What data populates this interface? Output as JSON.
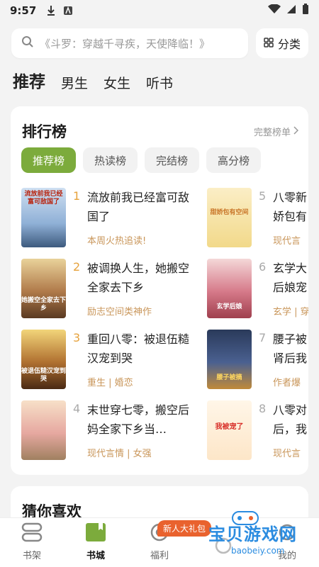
{
  "status_bar": {
    "time": "9:57"
  },
  "search": {
    "placeholder": "《斗罗：穿越千寻疾，天使降临！》"
  },
  "category_button": {
    "label": "分类"
  },
  "tabs": [
    {
      "label": "推荐",
      "active": true
    },
    {
      "label": "男生",
      "active": false
    },
    {
      "label": "女生",
      "active": false
    },
    {
      "label": "听书",
      "active": false
    }
  ],
  "ranking": {
    "title": "排行榜",
    "more_label": "完整榜单",
    "tabs": [
      "推荐榜",
      "热读榜",
      "完结榜",
      "高分榜"
    ],
    "books": [
      {
        "rank": "1",
        "title": "流放前我已经富可敌国了",
        "tag": "本周火热追读!",
        "cover_text": "流放前我已经富可敌国了"
      },
      {
        "rank": "2",
        "title": "被调换人生，她搬空全家去下乡",
        "tag": "励志空间类神作",
        "cover_text": "她搬空全家去下乡"
      },
      {
        "rank": "3",
        "title": "重回八零：被退伍糙汉宠到哭",
        "tag": "重生 | 婚恋",
        "cover_text": "被退伍糙汉宠到哭"
      },
      {
        "rank": "4",
        "title": "末世穿七零，搬空后妈全家下乡当…",
        "tag": "现代言情 | 女强",
        "cover_text": ""
      },
      {
        "rank": "5",
        "title": "八零新",
        "title2": "娇包有",
        "tag": "现代言",
        "cover_text": "甜娇包有空间"
      },
      {
        "rank": "6",
        "title": "玄学大",
        "title2": "后娘宠",
        "tag": "玄学 | 穿",
        "cover_text": "玄学后娘"
      },
      {
        "rank": "7",
        "title": "腰子被",
        "title2": "肾后我",
        "tag": "作者爆",
        "cover_text": "腰子被摘"
      },
      {
        "rank": "8",
        "title": "八零对",
        "title2": "后，我",
        "tag": "现代言",
        "cover_text": "我被宠了"
      }
    ]
  },
  "guess": {
    "title": "猜你喜欢"
  },
  "bottom_nav": [
    {
      "label": "书架",
      "icon": "bookshelf-icon",
      "active": false
    },
    {
      "label": "书城",
      "icon": "bookstore-icon",
      "active": true
    },
    {
      "label": "福利",
      "icon": "welfare-icon",
      "active": false
    },
    {
      "label": "",
      "icon": "",
      "active": false
    },
    {
      "label": "我的",
      "icon": "profile-icon",
      "active": false
    }
  ],
  "promo_badge": "新人大礼包",
  "watermark": {
    "title": "宝贝游戏网",
    "url": "baobeiy.com"
  },
  "colors": {
    "accent": "#7cab3c",
    "tag": "#c9965a",
    "rank": "#e6a23c"
  }
}
